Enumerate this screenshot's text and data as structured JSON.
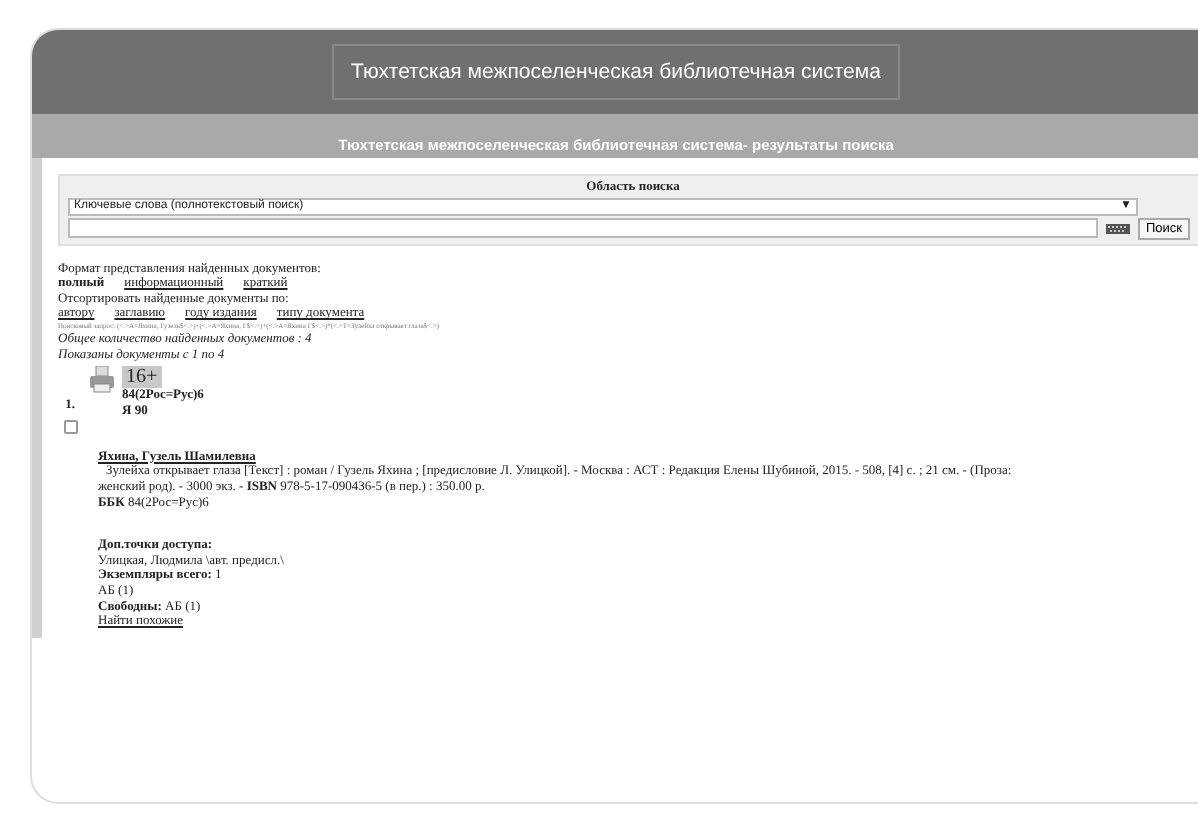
{
  "header": {
    "title": "Тюхтетская межпоселенческая библиотечная система"
  },
  "subtitle": "Тюхтетская межпоселенческая библиотечная система- результаты поиска",
  "search": {
    "area_label": "Область поиска",
    "scope": "Ключевые слова (полнотекстовый поиск)",
    "scope_arrow": "▼",
    "button": "Поиск"
  },
  "format": {
    "label": "Формат представления найденных документов:",
    "options": [
      {
        "label": "полный",
        "selected": true
      },
      {
        "label": "информационный",
        "selected": false
      },
      {
        "label": "краткий",
        "selected": false
      }
    ]
  },
  "sort": {
    "label": "Отсортировать найденные документы по:",
    "options": [
      "автору",
      "заглавию",
      "году издания",
      "типу документа"
    ]
  },
  "query": "Поисковый запрос: (<.>A=Яхина, Гузель$<.>)+(<.>A=Яхина, Г$<.>)+(<.>A=Яхина Г$<.>)*(<.>T=Зулейха открывает глаза$<.>)",
  "total": "Общее количество найденных документов : 4",
  "shown": "Показаны документы с 1 по 4",
  "results": [
    {
      "number": "1.",
      "checked": false,
      "age": "16+",
      "class_code": "84(2Рос=Рус)6",
      "author_mark": "Я 90",
      "author": "Яхина, Гузель Шамилевна",
      "description": "Зулейха открывает глаза [Текст] : роман / Гузель Яхина ; [предисловие Л. Улицкой]. - Москва : АСТ : Редакция Елены Шубиной, 2015. - 508, [4] с. ; 21 см. - (Проза: женский род). - 3000 экз. - **ISBN** 978-5-17-090436-5 (в пер.) : 350.00 р.",
      "bbk_label": "ББК",
      "bbk": "84(2Рос=Рус)6",
      "details": [
        {
          "label": "Доп.точки доступа:"
        },
        {
          "value": "Улицкая, Людмила \\авт. предисл.\\"
        },
        {
          "label": "Экземпляры всего:",
          "value": "1"
        },
        {
          "value": "АБ (1)"
        },
        {
          "label": "Свободны:",
          "value": "АБ (1)"
        }
      ],
      "similar_link": "Найти похожие"
    }
  ]
}
